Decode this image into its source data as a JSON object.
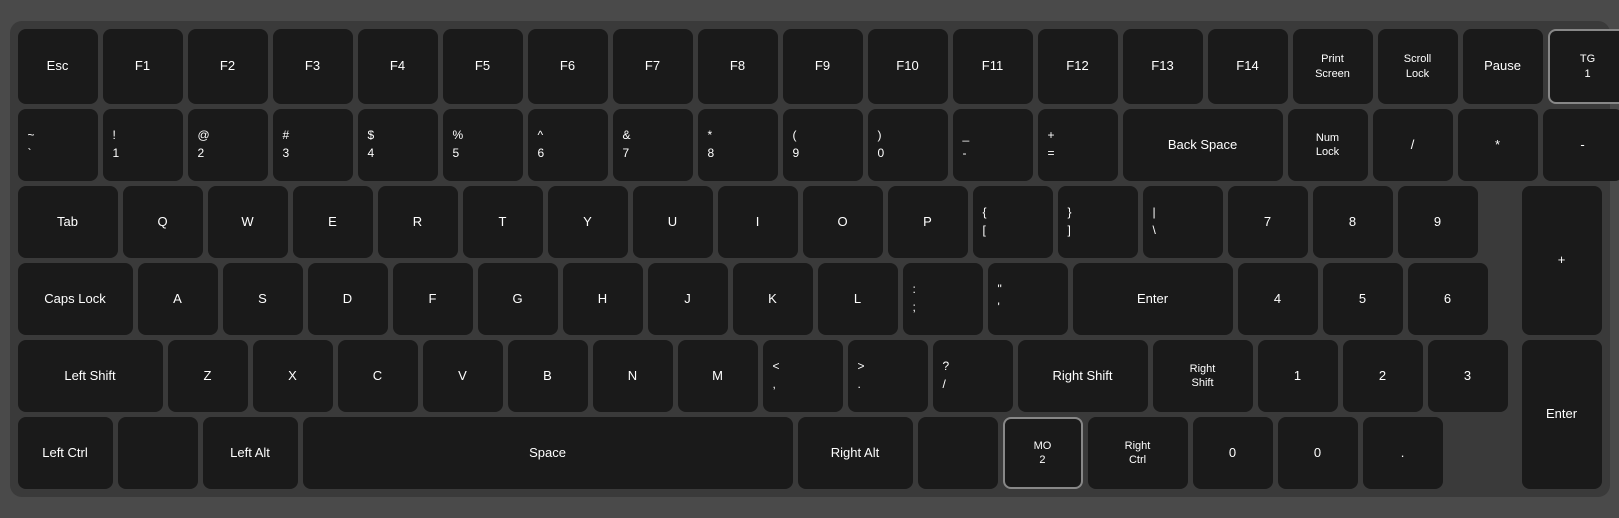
{
  "keyboard": {
    "rows": [
      {
        "id": "row1",
        "keys": [
          {
            "id": "esc",
            "label": "Esc",
            "width": "std"
          },
          {
            "id": "f1",
            "label": "F1",
            "width": "std"
          },
          {
            "id": "f2",
            "label": "F2",
            "width": "std"
          },
          {
            "id": "f3",
            "label": "F3",
            "width": "std"
          },
          {
            "id": "f4",
            "label": "F4",
            "width": "std"
          },
          {
            "id": "f5",
            "label": "F5",
            "width": "std"
          },
          {
            "id": "f6",
            "label": "F6",
            "width": "std"
          },
          {
            "id": "f7",
            "label": "F7",
            "width": "std"
          },
          {
            "id": "f8",
            "label": "F8",
            "width": "std"
          },
          {
            "id": "f9",
            "label": "F9",
            "width": "std"
          },
          {
            "id": "f10",
            "label": "F10",
            "width": "std"
          },
          {
            "id": "f11",
            "label": "F11",
            "width": "std"
          },
          {
            "id": "f12",
            "label": "F12",
            "width": "std"
          },
          {
            "id": "f13",
            "label": "F13",
            "width": "std"
          },
          {
            "id": "f14",
            "label": "F14",
            "width": "std"
          },
          {
            "id": "print-screen",
            "label": "Print\nScreen",
            "width": "std"
          },
          {
            "id": "scroll-lock",
            "label": "Scroll\nLock",
            "width": "std"
          },
          {
            "id": "pause",
            "label": "Pause",
            "width": "std"
          },
          {
            "id": "tg1",
            "label": "TG\n1",
            "width": "tg",
            "special": "tg-highlighted"
          }
        ]
      },
      {
        "id": "row2",
        "keys": [
          {
            "id": "tilde",
            "top": "~",
            "bottom": "`",
            "width": "std",
            "dual": true
          },
          {
            "id": "1",
            "top": "!",
            "bottom": "1",
            "width": "std",
            "dual": true
          },
          {
            "id": "2",
            "top": "@",
            "bottom": "2",
            "width": "std",
            "dual": true
          },
          {
            "id": "3",
            "top": "#",
            "bottom": "3",
            "width": "std",
            "dual": true
          },
          {
            "id": "4",
            "top": "$",
            "bottom": "4",
            "width": "std",
            "dual": true
          },
          {
            "id": "5",
            "top": "%",
            "bottom": "5",
            "width": "std",
            "dual": true
          },
          {
            "id": "6",
            "top": "^",
            "bottom": "6",
            "width": "std",
            "dual": true
          },
          {
            "id": "7",
            "top": "&",
            "bottom": "7",
            "width": "std",
            "dual": true
          },
          {
            "id": "8",
            "top": "*",
            "bottom": "8",
            "width": "std",
            "dual": true
          },
          {
            "id": "9",
            "top": "(",
            "bottom": "9",
            "width": "std",
            "dual": true
          },
          {
            "id": "0",
            "top": ")",
            "bottom": "0",
            "width": "std",
            "dual": true
          },
          {
            "id": "minus",
            "top": "_",
            "bottom": "-",
            "width": "std",
            "dual": true
          },
          {
            "id": "equals",
            "top": "+",
            "bottom": "=",
            "width": "std",
            "dual": true
          },
          {
            "id": "backspace",
            "label": "Back Space",
            "width": "backspace"
          },
          {
            "id": "numlock",
            "label": "Num\nLock",
            "width": "std"
          },
          {
            "id": "numslash",
            "label": "/",
            "width": "std"
          },
          {
            "id": "numstar",
            "label": "*",
            "width": "std"
          },
          {
            "id": "numminus",
            "label": "-",
            "width": "std"
          }
        ]
      },
      {
        "id": "row3",
        "keys": [
          {
            "id": "tab",
            "label": "Tab",
            "width": "wide-tab"
          },
          {
            "id": "q",
            "label": "Q",
            "width": "std"
          },
          {
            "id": "w",
            "label": "W",
            "width": "std"
          },
          {
            "id": "e",
            "label": "E",
            "width": "std"
          },
          {
            "id": "r",
            "label": "R",
            "width": "std"
          },
          {
            "id": "t",
            "label": "T",
            "width": "std"
          },
          {
            "id": "y",
            "label": "Y",
            "width": "std"
          },
          {
            "id": "u",
            "label": "U",
            "width": "std"
          },
          {
            "id": "i",
            "label": "I",
            "width": "std"
          },
          {
            "id": "o",
            "label": "O",
            "width": "std"
          },
          {
            "id": "p",
            "label": "P",
            "width": "std"
          },
          {
            "id": "lbracket",
            "top": "{",
            "bottom": "[",
            "width": "std",
            "dual": true
          },
          {
            "id": "rbracket",
            "top": "}",
            "bottom": "]",
            "width": "std",
            "dual": true
          },
          {
            "id": "backslash",
            "top": "\\",
            "bottom": "\\",
            "width": "std",
            "dual": true
          },
          {
            "id": "num7",
            "label": "7",
            "width": "std"
          },
          {
            "id": "num8",
            "label": "8",
            "width": "std"
          },
          {
            "id": "num9",
            "label": "9",
            "width": "std"
          },
          {
            "id": "numplus",
            "label": "+",
            "width": "std",
            "tall": true
          }
        ]
      },
      {
        "id": "row4",
        "keys": [
          {
            "id": "capslock",
            "label": "Caps Lock",
            "width": "wide-caps"
          },
          {
            "id": "a",
            "label": "A",
            "width": "std"
          },
          {
            "id": "s",
            "label": "S",
            "width": "std"
          },
          {
            "id": "d",
            "label": "D",
            "width": "std"
          },
          {
            "id": "f",
            "label": "F",
            "width": "std"
          },
          {
            "id": "g",
            "label": "G",
            "width": "std"
          },
          {
            "id": "h",
            "label": "H",
            "width": "std"
          },
          {
            "id": "j",
            "label": "J",
            "width": "std"
          },
          {
            "id": "k",
            "label": "K",
            "width": "std"
          },
          {
            "id": "l",
            "label": "L",
            "width": "std"
          },
          {
            "id": "semicolon",
            "top": ":",
            "bottom": ";",
            "width": "std",
            "dual": true
          },
          {
            "id": "quote",
            "top": "\"",
            "bottom": "'",
            "width": "std",
            "dual": true
          },
          {
            "id": "enter",
            "label": "Enter",
            "width": "wide-enter"
          },
          {
            "id": "num4",
            "label": "4",
            "width": "std"
          },
          {
            "id": "num5",
            "label": "5",
            "width": "std"
          },
          {
            "id": "num6",
            "label": "6",
            "width": "std"
          }
        ]
      },
      {
        "id": "row5",
        "keys": [
          {
            "id": "left-shift",
            "label": "Left Shift",
            "width": "wide-lshift"
          },
          {
            "id": "z",
            "label": "Z",
            "width": "std"
          },
          {
            "id": "x",
            "label": "X",
            "width": "std"
          },
          {
            "id": "c",
            "label": "C",
            "width": "std"
          },
          {
            "id": "v",
            "label": "V",
            "width": "std"
          },
          {
            "id": "b",
            "label": "B",
            "width": "std"
          },
          {
            "id": "n",
            "label": "N",
            "width": "std"
          },
          {
            "id": "m",
            "label": "M",
            "width": "std"
          },
          {
            "id": "comma",
            "top": "<",
            "bottom": ",",
            "width": "std",
            "dual": true
          },
          {
            "id": "period",
            "top": ">",
            "bottom": ".",
            "width": "std",
            "dual": true
          },
          {
            "id": "slash",
            "top": "?",
            "bottom": "/",
            "width": "std",
            "dual": true
          },
          {
            "id": "right-shift",
            "label": "Right Shift",
            "width": "wide-rshift"
          },
          {
            "id": "right-shift2",
            "label": "Right\nShift",
            "width": "wide-rshift2"
          },
          {
            "id": "num1",
            "label": "1",
            "width": "std"
          },
          {
            "id": "num2",
            "label": "2",
            "width": "std"
          },
          {
            "id": "num3",
            "label": "3",
            "width": "std"
          },
          {
            "id": "numenter",
            "label": "Enter",
            "width": "std",
            "tall": true
          }
        ]
      },
      {
        "id": "row6",
        "keys": [
          {
            "id": "left-ctrl",
            "label": "Left Ctrl",
            "width": "wide-ctrl"
          },
          {
            "id": "left-apple",
            "label": "",
            "width": "std",
            "apple": true
          },
          {
            "id": "left-alt",
            "label": "Left Alt",
            "width": "wide-ctrl"
          },
          {
            "id": "space",
            "label": "Space",
            "width": "wide-space"
          },
          {
            "id": "right-alt",
            "label": "Right Alt",
            "width": "wide-ctrl"
          },
          {
            "id": "right-apple",
            "label": "",
            "width": "std",
            "apple": true
          },
          {
            "id": "mo2",
            "label": "MO\n2",
            "width": "std",
            "special": "mo2"
          },
          {
            "id": "right-ctrl",
            "label": "Right\nCtrl",
            "width": "wide-ctrl"
          },
          {
            "id": "num0a",
            "label": "0",
            "width": "std"
          },
          {
            "id": "num0b",
            "label": "0",
            "width": "std"
          },
          {
            "id": "numdot",
            "label": ".",
            "width": "std"
          }
        ]
      }
    ]
  }
}
